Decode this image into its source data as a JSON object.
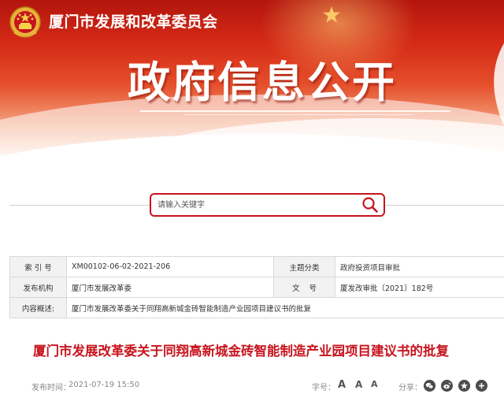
{
  "header": {
    "site_name": "厦门市发展和改革委员会",
    "hero_title": "政府信息公开"
  },
  "search": {
    "placeholder": "请输入关键字",
    "value": ""
  },
  "info": {
    "index_label": "索 引 号",
    "index_value": "XM00102-06-02-2021-206",
    "category_label": "主题分类",
    "category_value": "政府投资项目审批",
    "publisher_label": "发布机构",
    "publisher_value": "厦门市发展改革委",
    "docno_label": "文    号",
    "docno_value": "厦发改审批〔2021〕182号",
    "summary_label": "内容概述:",
    "summary_value": "厦门市发展改革委关于同翔高新城金砖智能制造产业园项目建议书的批复"
  },
  "article": {
    "title": "厦门市发展改革委关于同翔高新城金砖智能制造产业园项目建议书的批复",
    "publish_label": "发布时间：",
    "publish_date": "2021-07-19 15:50",
    "fontsize_label": "字号：",
    "fontsize_large": "A",
    "fontsize_medium": "A",
    "fontsize_small": "A",
    "share_label": "分享："
  },
  "icons": {
    "emblem": "national-emblem-icon",
    "search": "search-icon",
    "share": [
      "wechat-icon",
      "weibo-icon",
      "qzone-icon",
      "more-share-icon"
    ]
  },
  "colors": {
    "brand_red": "#c8141e",
    "banner_red": "#d52a17",
    "table_label_bg": "#f2f2f2"
  }
}
